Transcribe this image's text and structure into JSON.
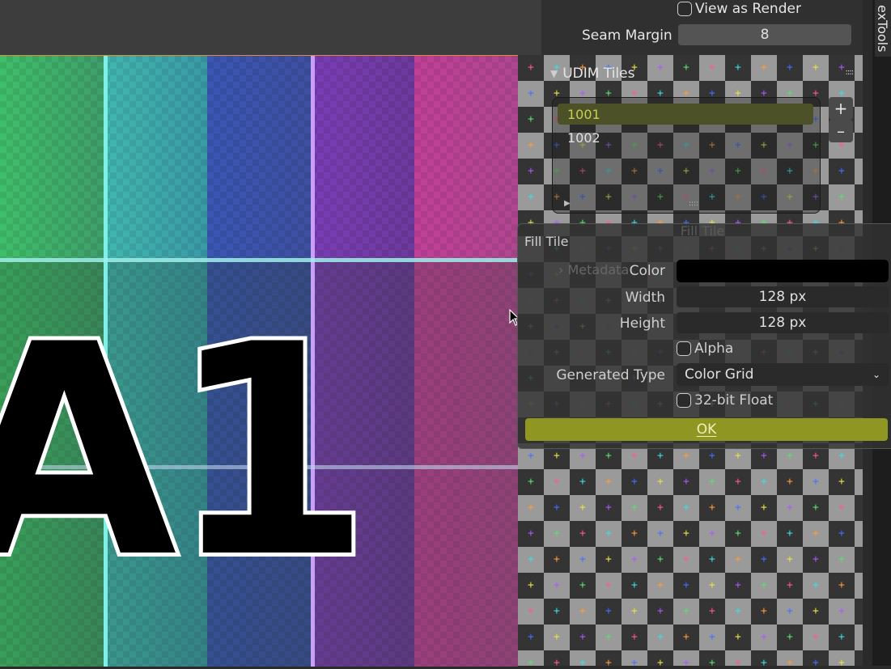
{
  "top_properties": {
    "view_as_render_label": "View as Render",
    "seam_margin_label": "Seam Margin",
    "seam_margin_value": "8"
  },
  "udim_panel": {
    "title": "UDIM Tiles",
    "tiles": [
      "1001",
      "1002"
    ],
    "selected_tile": "1001",
    "add_icon": "plus",
    "remove_icon": "minus"
  },
  "sidebar_tab": {
    "label": "exTools"
  },
  "background_panel": {
    "fill_tile_label": "Fill Tile",
    "metadata_label": "Metadata"
  },
  "viewport": {
    "tile_text": "A1"
  },
  "popup": {
    "title": "Fill Tile",
    "color_label": "Color",
    "color_value": "#000000",
    "width_label": "Width",
    "width_value": "128 px",
    "height_label": "Height",
    "height_value": "128 px",
    "alpha_label": "Alpha",
    "generated_type_label": "Generated Type",
    "generated_type_value": "Color Grid",
    "float_label": "32-bit Float",
    "ok_label": "OK"
  },
  "colors": {
    "accent_selected": "#4c5128",
    "accent_text": "#c7cf57",
    "ok_button": "#8f9622"
  }
}
